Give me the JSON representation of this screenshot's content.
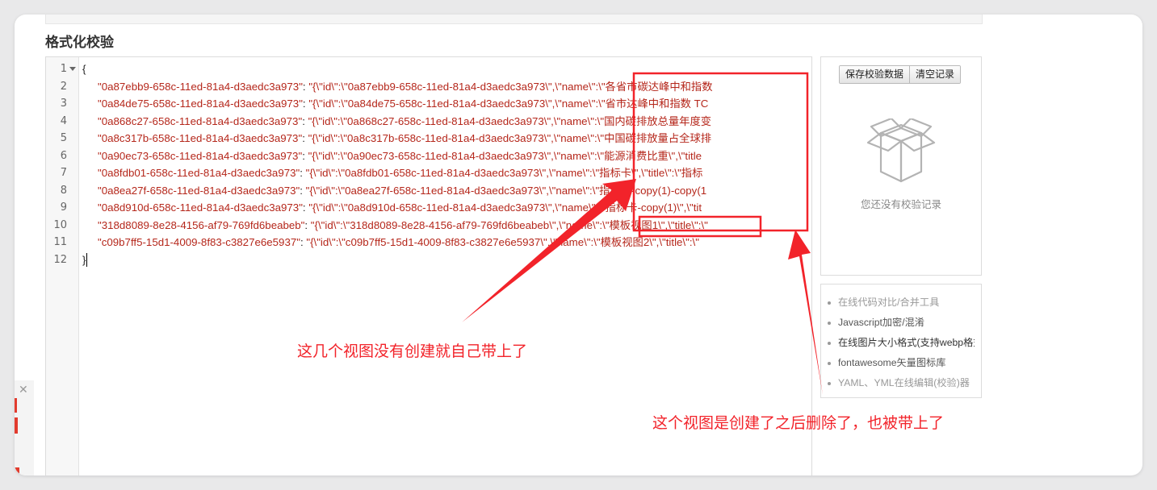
{
  "section": {
    "title": "格式化校验"
  },
  "editor": {
    "line_numbers": [
      "1",
      "2",
      "3",
      "4",
      "5",
      "6",
      "7",
      "8",
      "9",
      "10",
      "11",
      "12"
    ],
    "open_brace": "{",
    "close_brace": "}",
    "entries": [
      {
        "key": "\"0a87ebb9-658c-11ed-81a4-d3aedc3a973\"",
        "value": "\"{\\\"id\\\":\\\"0a87ebb9-658c-11ed-81a4-d3aedc3a973\\\",\\\"name\\\":\\\"各省市碳达峰中和指数"
      },
      {
        "key": "\"0a84de75-658c-11ed-81a4-d3aedc3a973\"",
        "value": "\"{\\\"id\\\":\\\"0a84de75-658c-11ed-81a4-d3aedc3a973\\\",\\\"name\\\":\\\"省市达峰中和指数 TC"
      },
      {
        "key": "\"0a868c27-658c-11ed-81a4-d3aedc3a973\"",
        "value": "\"{\\\"id\\\":\\\"0a868c27-658c-11ed-81a4-d3aedc3a973\\\",\\\"name\\\":\\\"国内碳排放总量年度变"
      },
      {
        "key": "\"0a8c317b-658c-11ed-81a4-d3aedc3a973\"",
        "value": "\"{\\\"id\\\":\\\"0a8c317b-658c-11ed-81a4-d3aedc3a973\\\",\\\"name\\\":\\\"中国碳排放量占全球排"
      },
      {
        "key": "\"0a90ec73-658c-11ed-81a4-d3aedc3a973\"",
        "value": "\"{\\\"id\\\":\\\"0a90ec73-658c-11ed-81a4-d3aedc3a973\\\",\\\"name\\\":\\\"能源消费比重\\\",\\\"title"
      },
      {
        "key": "\"0a8fdb01-658c-11ed-81a4-d3aedc3a973\"",
        "value": "\"{\\\"id\\\":\\\"0a8fdb01-658c-11ed-81a4-d3aedc3a973\\\",\\\"name\\\":\\\"指标卡\\\",\\\"title\\\":\\\"指标"
      },
      {
        "key": "\"0a8ea27f-658c-11ed-81a4-d3aedc3a973\"",
        "value": "\"{\\\"id\\\":\\\"0a8ea27f-658c-11ed-81a4-d3aedc3a973\\\",\\\"name\\\":\\\"指标卡-copy(1)-copy(1"
      },
      {
        "key": "\"0a8d910d-658c-11ed-81a4-d3aedc3a973\"",
        "value": "\"{\\\"id\\\":\\\"0a8d910d-658c-11ed-81a4-d3aedc3a973\\\",\\\"name\\\":\\\"指标卡-copy(1)\\\",\\\"tit"
      },
      {
        "key": "\"318d8089-8e28-4156-af79-769fd6beabeb\"",
        "value": "\"{\\\"id\\\":\\\"318d8089-8e28-4156-af79-769fd6beabeb\\\",\\\"name\\\":\\\"模板视图1\\\",\\\"title\\\":\\\""
      },
      {
        "key": "\"c09b7ff5-15d1-4009-8f83-c3827e6e5937\"",
        "value": "\"{\\\"id\\\":\\\"c09b7ff5-15d1-4009-8f83-c3827e6e5937\\\",\\\"name\\\":\\\"模板视图2\\\",\\\"title\\\":\\\""
      }
    ]
  },
  "sidebar": {
    "save_button": "保存校验数据",
    "clear_button": "清空记录",
    "empty_text": "您还没有校验记录",
    "links": [
      {
        "label": "在线代码对比/合并工具",
        "color": "#999999"
      },
      {
        "label": "Javascript加密/混淆",
        "color": "#555555"
      },
      {
        "label": "在线图片大小格式(支持webp格式)转换",
        "color": "#333333"
      },
      {
        "label": "fontawesome矢量图标库",
        "color": "#555555"
      },
      {
        "label": "YAML、YML在线编辑(校验)器",
        "color": "#999999"
      }
    ]
  },
  "annotations": {
    "color": "#f2232a",
    "text_1": "这几个视图没有创建就自己带上了",
    "text_2": "这个视图是创建了之后删除了，也被带上了"
  }
}
